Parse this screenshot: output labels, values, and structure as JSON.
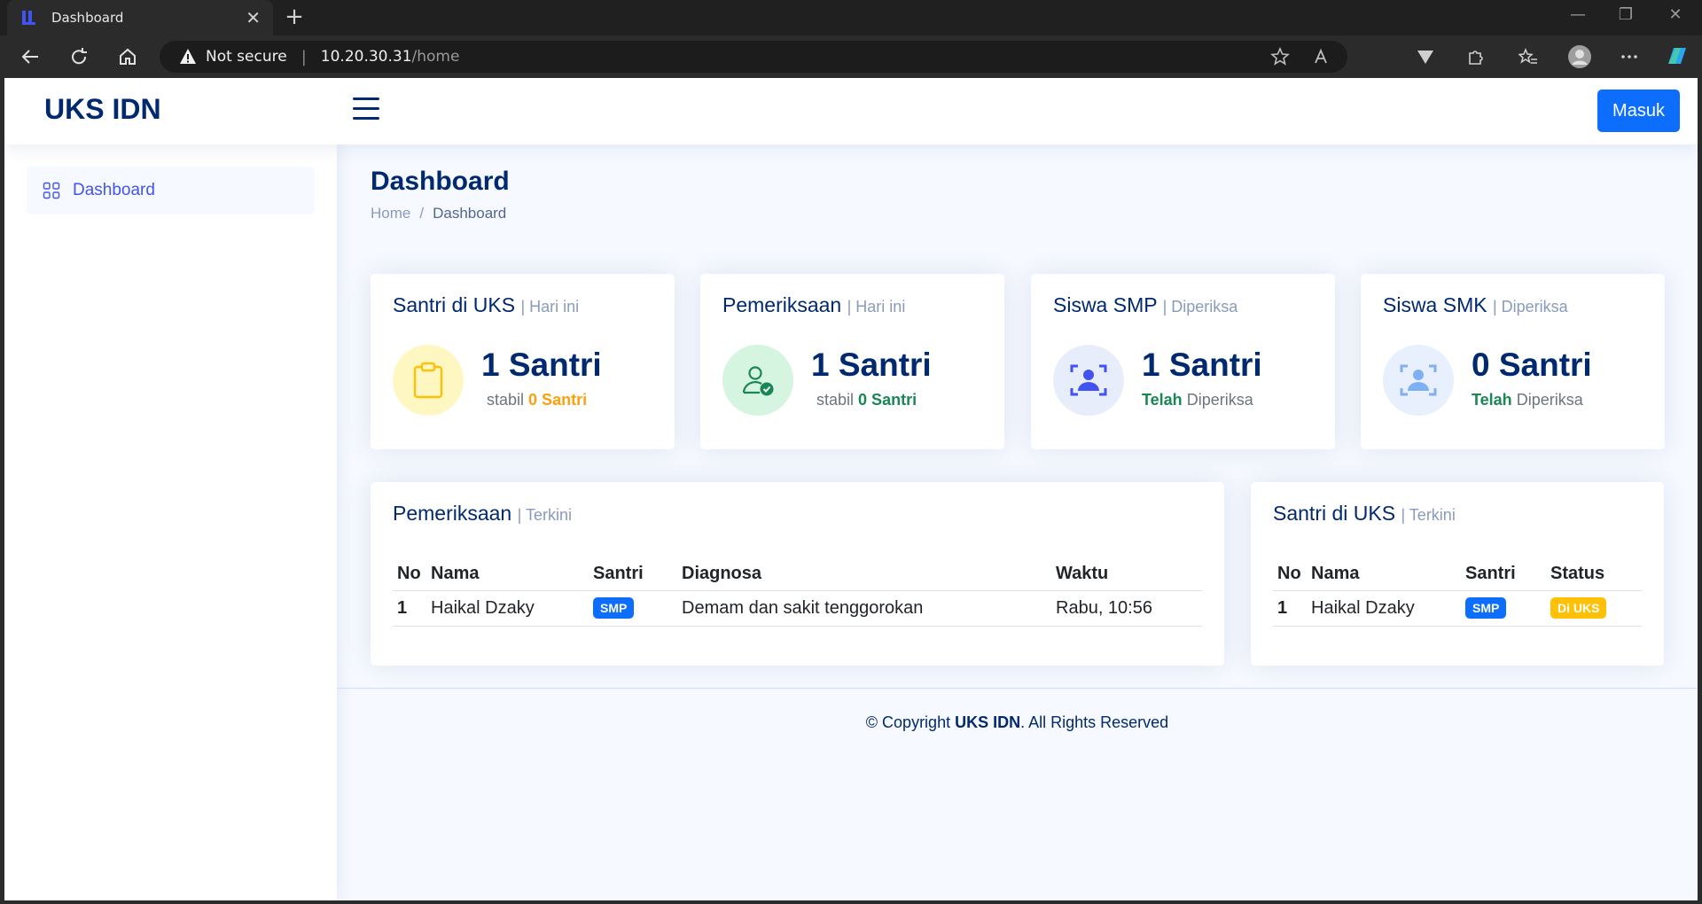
{
  "browser": {
    "tab_title": "Dashboard",
    "address_secure_label": "Not secure",
    "address_host": "10.20.30.31",
    "address_path": "/home"
  },
  "header": {
    "logo": "UKS IDN",
    "login_label": "Masuk"
  },
  "sidebar": {
    "items": [
      {
        "label": "Dashboard",
        "icon": "grid-icon"
      }
    ]
  },
  "main": {
    "page_title": "Dashboard",
    "breadcrumb": [
      "Home",
      "/",
      "Dashboard"
    ]
  },
  "cards": [
    {
      "title": "Santri di UKS",
      "subtitle": "| Hari ini",
      "value": "1 Santri",
      "sub_prefix": "stabil",
      "sub_strong": "0 Santri",
      "strong_color": "#ff9f0a",
      "icon": "clipboard-icon"
    },
    {
      "title": "Pemeriksaan",
      "subtitle": "| Hari ini",
      "value": "1 Santri",
      "sub_prefix": "stabil",
      "sub_strong": "0 Santri",
      "strong_color": "#198754",
      "icon": "person-check-icon"
    },
    {
      "title": "Siswa SMP",
      "subtitle": "| Diperiksa",
      "value": "1 Santri",
      "sub_strong": "Telah",
      "sub_suffix": "Diperiksa",
      "strong_color": "#198754",
      "icon": "person-scan-icon"
    },
    {
      "title": "Siswa SMK",
      "subtitle": "| Diperiksa",
      "value": "0 Santri",
      "sub_strong": "Telah",
      "sub_suffix": "Diperiksa",
      "strong_color": "#198754",
      "icon": "person-scan-icon"
    }
  ],
  "recent_checks": {
    "title": "Pemeriksaan",
    "subtitle": "| Terkini",
    "columns": [
      "No",
      "Nama",
      "Santri",
      "Diagnosa",
      "Waktu"
    ],
    "rows": [
      {
        "no": "1",
        "nama": "Haikal Dzaky",
        "santri": "SMP",
        "diagnosa": "Demam dan sakit tenggorokan",
        "waktu": "Rabu, 10:56"
      }
    ]
  },
  "santri_uks": {
    "title": "Santri di UKS",
    "subtitle": "| Terkini",
    "columns": [
      "No",
      "Nama",
      "Santri",
      "Status"
    ],
    "rows": [
      {
        "no": "1",
        "nama": "Haikal Dzaky",
        "santri": "SMP",
        "status": "Di UKS"
      }
    ]
  },
  "footer": {
    "prefix": "© Copyright",
    "brand": "UKS IDN",
    "suffix": ". All Rights Reserved"
  },
  "colors": {
    "accent": "#4154f1",
    "brand": "#012970",
    "primary_button": "#0d6efd",
    "warning": "#ffc107"
  }
}
